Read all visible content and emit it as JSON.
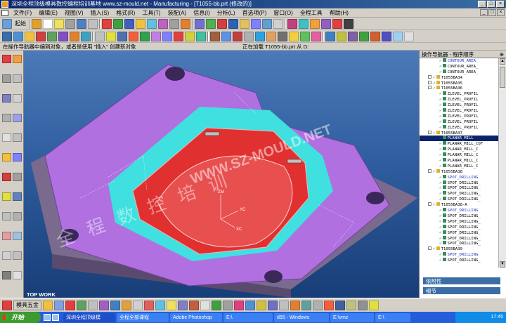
{
  "window": {
    "title": "深圳全程顶级模具数控编程培训基地 www.sz-mould.net - Manufacturing - [T1055-bb.prt (修改的)]",
    "controls": [
      "_",
      "□",
      "×"
    ]
  },
  "menu": {
    "items": [
      "文件(F)",
      "编辑(E)",
      "视图(V)",
      "插入(S)",
      "格式(R)",
      "工具(T)",
      "装配(A)",
      "信息(I)",
      "分析(L)",
      "首选项(P)",
      "窗口(O)",
      "全程工具",
      "帮助(H)"
    ]
  },
  "toolbar": {
    "start_label": "起始",
    "colors": [
      "#e0a030",
      "#ffffff",
      "#f0e060",
      "#a0a0a0",
      "#5080c0",
      "#c0c0c0",
      "#e04040",
      "#40a040",
      "#4060c0",
      "#f0c040",
      "#60c0e0",
      "#c060c0",
      "#a0a0a0",
      "#e08030",
      "#7070d0",
      "#50b050",
      "#d04040",
      "#3060b0",
      "#e0c060",
      "#8080ff",
      "#60a0d0",
      "#d0d0d0",
      "#c04080",
      "#40c0c0",
      "#f0a040",
      "#9060c0",
      "#e04040",
      "#404040"
    ]
  },
  "toolbar2": {
    "colors": [
      "#3a6ea5",
      "#5090d0",
      "#f0c040",
      "#d04040",
      "#60a060",
      "#8050c0",
      "#e08030",
      "#40a0c0",
      "#c0c0c0",
      "#e0e040",
      "#5070b0",
      "#f06040",
      "#30a050",
      "#c080e0",
      "#8080ff",
      "#e04040",
      "#d0d040",
      "#40c0a0",
      "#a06040",
      "#6090e0",
      "#c04040",
      "#b0b0b0",
      "#30a0e0",
      "#e0a060",
      "#707070",
      "#f0d040",
      "#60c060",
      "#e060a0",
      "#4080c0",
      "#c0c040",
      "#8060a0",
      "#40a040",
      "#d06030",
      "#5050c0",
      "#a0d0f0",
      "#e0e0e0"
    ]
  },
  "status": {
    "prompt": "在操作导航器中编辑对象，或者是使用 \"插入\" 创建新对象",
    "loading": "正在加载 T1055-bb.prt 从 D:"
  },
  "viewport": {
    "label": "TOP WORK",
    "watermark": "WWW.SZ-MOULD.NET",
    "watermark_cn": "全程数控培训",
    "axes": [
      "ZM",
      "YC",
      "XC"
    ]
  },
  "navigator": {
    "title": "操作导航器 - 程序顺序",
    "nodes": [
      {
        "indent": 3,
        "text": "CONTOUR_AREA_",
        "type": "op",
        "blue": true
      },
      {
        "indent": 3,
        "text": "CONTOUR_AREA_",
        "type": "op"
      },
      {
        "indent": 3,
        "text": "CONTOUR_AREA_",
        "type": "op"
      },
      {
        "indent": 1,
        "text": "T1055BA34",
        "type": "group"
      },
      {
        "indent": 1,
        "text": "T1055BA35",
        "type": "group"
      },
      {
        "indent": 1,
        "text": "T1055BA36",
        "type": "group"
      },
      {
        "indent": 3,
        "text": "ZLEVEL_PROFIL",
        "type": "op"
      },
      {
        "indent": 3,
        "text": "ZLEVEL_PROFIL",
        "type": "op"
      },
      {
        "indent": 3,
        "text": "ZLEVEL_PROFIL",
        "type": "op"
      },
      {
        "indent": 3,
        "text": "ZLEVEL_PROFIL",
        "type": "op"
      },
      {
        "indent": 3,
        "text": "ZLEVEL_PROFIL",
        "type": "op"
      },
      {
        "indent": 3,
        "text": "ZLEVEL_PROFIL",
        "type": "op"
      },
      {
        "indent": 3,
        "text": "ZLEVEL_PROFIL",
        "type": "op"
      },
      {
        "indent": 1,
        "text": "T1055BA37",
        "type": "group"
      },
      {
        "indent": 3,
        "text": "PLANAR_MILL",
        "type": "op",
        "sel": true
      },
      {
        "indent": 3,
        "text": "PLANAR_MILL_COF",
        "type": "op"
      },
      {
        "indent": 3,
        "text": "PLANAR_MILL_C",
        "type": "op"
      },
      {
        "indent": 3,
        "text": "PLANAR_MILL_C",
        "type": "op"
      },
      {
        "indent": 3,
        "text": "PLANAR_MILL_C",
        "type": "op"
      },
      {
        "indent": 3,
        "text": "PLANAR_MILL_C",
        "type": "op"
      },
      {
        "indent": 1,
        "text": "T1055BA38",
        "type": "group"
      },
      {
        "indent": 3,
        "text": "SPOT_DRILLING",
        "type": "op",
        "blue": true
      },
      {
        "indent": 3,
        "text": "SPOT_DRILLING_",
        "type": "op"
      },
      {
        "indent": 3,
        "text": "SPOT_DRILLING_",
        "type": "op"
      },
      {
        "indent": 3,
        "text": "SPOT_DRILLING_",
        "type": "op"
      },
      {
        "indent": 3,
        "text": "SPOT_DRILLING_",
        "type": "op"
      },
      {
        "indent": 1,
        "text": "T1055BA38-A",
        "type": "group"
      },
      {
        "indent": 3,
        "text": "SPOT_DRILLING",
        "type": "op",
        "blue": true
      },
      {
        "indent": 3,
        "text": "SPOT_DRILLING_",
        "type": "op"
      },
      {
        "indent": 3,
        "text": "SPOT_DRILLING_",
        "type": "op"
      },
      {
        "indent": 3,
        "text": "SPOT_DRILLING_",
        "type": "op"
      },
      {
        "indent": 3,
        "text": "SPOT_DRILLING_",
        "type": "op"
      },
      {
        "indent": 3,
        "text": "SPOT_DRILLING_",
        "type": "op"
      },
      {
        "indent": 3,
        "text": "SPOT_DRILLING_",
        "type": "op"
      },
      {
        "indent": 1,
        "text": "T1055BA39",
        "type": "group"
      },
      {
        "indent": 3,
        "text": "SPOT_DRILLING",
        "type": "op",
        "blue": true
      },
      {
        "indent": 3,
        "text": "SPOT_DRILLING_",
        "type": "op"
      }
    ],
    "dependency_label": "依附性",
    "detail_label": "细节"
  },
  "bottombar": {
    "label": "模具五金"
  },
  "taskbar": {
    "start_label": "开始",
    "tasks": [
      "深圳全程顶级模",
      "全程全部课程",
      "Adobe Photoshop",
      "E:\\",
      "d55 - Windows",
      "E:\\vmz",
      "E:\\"
    ],
    "clock": "17:45"
  }
}
